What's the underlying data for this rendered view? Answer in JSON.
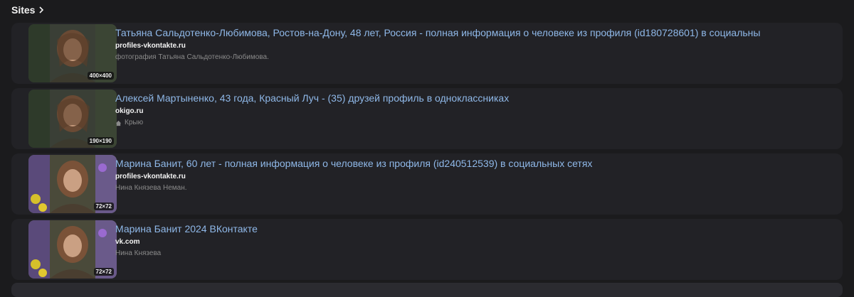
{
  "header": {
    "title": "Sites"
  },
  "results": [
    {
      "title": "Татьяна Сальдотенко-Любимова, Ростов-на-Дону, 48 лет, Россия - полная информация о человеке из профиля (id180728601) в социальны",
      "domain": "profiles-vkontakte.ru",
      "snippet": "фотография Татьяна Сальдотенко-Любимова.",
      "badge": "400×400",
      "icon": null
    },
    {
      "title": "Алексей Мартыненко, 43 года, Красный Луч - (35) друзей профиль в одноклассниках",
      "domain": "okigo.ru",
      "snippet": "Крыю",
      "badge": "190×190",
      "icon": "home-icon"
    },
    {
      "title": "Марина Банит, 60 лет - полная информация о человеке из профиля (id240512539) в социальных сетях",
      "domain": "profiles-vkontakte.ru",
      "snippet": "Нина Князева Неман.",
      "badge": "72×72",
      "icon": null
    },
    {
      "title": "Марина Банит 2024 ВКонтакте",
      "domain": "vk.com",
      "snippet": "Нина Князева",
      "badge": "72×72",
      "icon": null
    }
  ]
}
